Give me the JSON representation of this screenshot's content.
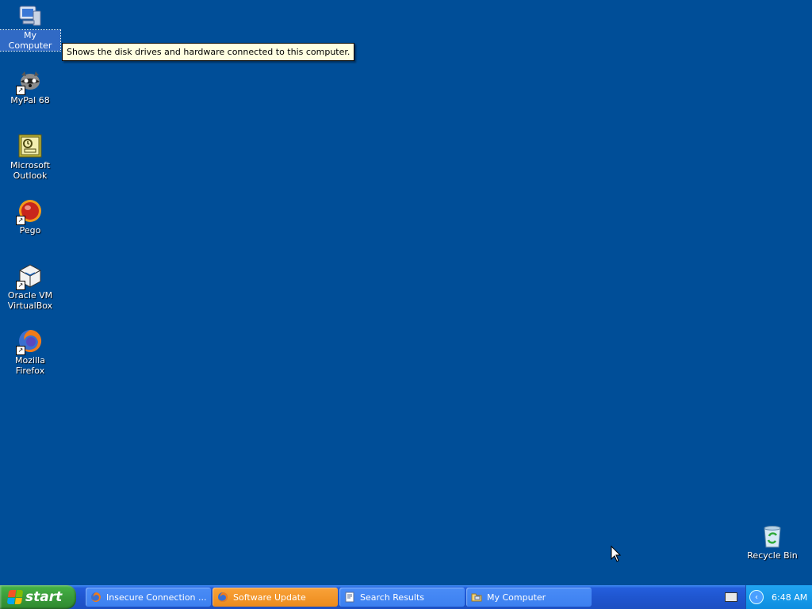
{
  "desktop": {
    "icons": [
      {
        "label": "My Computer"
      },
      {
        "label": "MyPal 68"
      },
      {
        "label": "Microsoft Outlook"
      },
      {
        "label": "Pego"
      },
      {
        "label": "Oracle VM VirtualBox"
      },
      {
        "label": "Mozilla Firefox"
      }
    ],
    "recycle_bin": {
      "label": "Recycle Bin"
    },
    "tooltip": "Shows the disk drives and hardware connected to this computer."
  },
  "taskbar": {
    "start_label": "start",
    "tasks": [
      {
        "label": "Insecure Connection ...",
        "icon": "firefox-icon"
      },
      {
        "label": "Software Update",
        "icon": "firefox-icon"
      },
      {
        "label": "Search Results",
        "icon": "document-search-icon"
      },
      {
        "label": "My Computer",
        "icon": "folder-computer-icon"
      }
    ],
    "clock": "6:48 AM"
  },
  "colors": {
    "desktop_bg": "#004e98",
    "taskbar": "#245edc",
    "active_task": "#ec8b1c",
    "start_green": "#3a9b3a"
  }
}
